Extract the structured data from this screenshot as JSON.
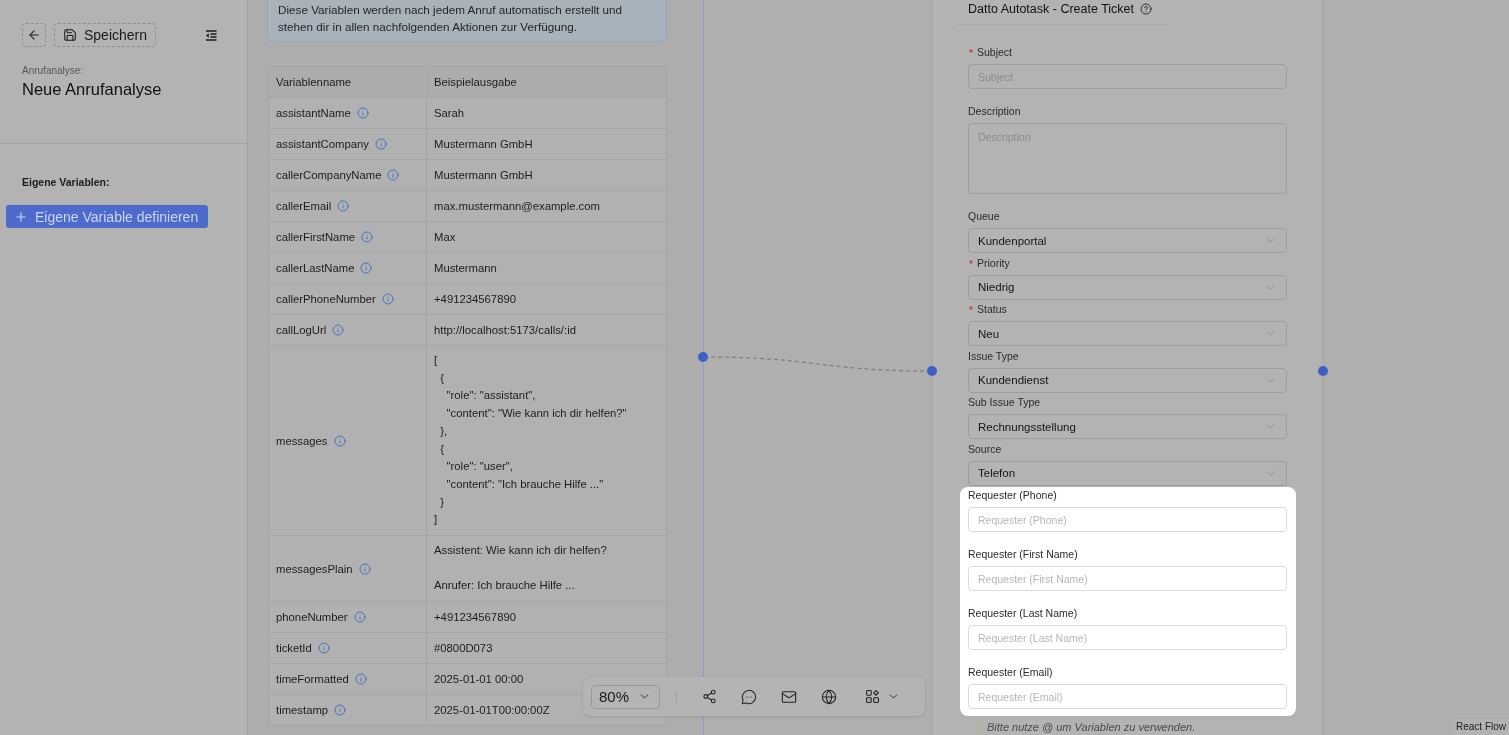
{
  "header": {
    "save_label": "Speichern",
    "caption": "Anrufanalyse:",
    "title": "Neue Anrufanalyse"
  },
  "custom_variables": {
    "heading": "Eigene Variablen:",
    "add_label": "Eigene Variable definieren"
  },
  "info_notice": "Diese Variablen werden nach jedem Anruf automatisch erstellt und stehen dir in allen nachfolgenden Aktionen zur Verfügung.",
  "variables_table": {
    "columns": [
      "Variablenname",
      "Beispielausgabe"
    ],
    "rows": [
      {
        "name": "assistantName",
        "example": "Sarah"
      },
      {
        "name": "assistantCompany",
        "example": "Mustermann GmbH"
      },
      {
        "name": "callerCompanyName",
        "example": "Mustermann GmbH"
      },
      {
        "name": "callerEmail",
        "example": "max.mustermann@example.com"
      },
      {
        "name": "callerFirstName",
        "example": "Max"
      },
      {
        "name": "callerLastName",
        "example": "Mustermann"
      },
      {
        "name": "callerPhoneNumber",
        "example": "+491234567890"
      },
      {
        "name": "callLogUrl",
        "example": "http://localhost:5173/calls/:id"
      },
      {
        "name": "messages",
        "example": "[\n  {\n    \"role\": \"assistant\",\n    \"content\": \"Wie kann ich dir helfen?\"\n  },\n  {\n    \"role\": \"user\",\n    \"content\": \"Ich brauche Hilfe ...\"\n  }\n]"
      },
      {
        "name": "messagesPlain",
        "example": "Assistent: Wie kann ich dir helfen?\n\nAnrufer: Ich brauche Hilfe ..."
      },
      {
        "name": "phoneNumber",
        "example": "+491234567890"
      },
      {
        "name": "ticketId",
        "example": "#0800D073"
      },
      {
        "name": "timeFormatted",
        "example": "2025-01-01 00:00"
      },
      {
        "name": "timestamp",
        "example": "2025-01-01T00:00:00Z"
      }
    ]
  },
  "node": {
    "title": "Datto Autotask - Create Ticket",
    "fields": [
      {
        "kind": "text",
        "label": "Subject",
        "required": true,
        "placeholder": "Subject"
      },
      {
        "kind": "textarea",
        "label": "Description",
        "required": false,
        "placeholder": "Description"
      },
      {
        "kind": "select",
        "label": "Queue",
        "required": false,
        "value": "Kundenportal"
      },
      {
        "kind": "select",
        "label": "Priority",
        "required": true,
        "value": "Niedrig"
      },
      {
        "kind": "select",
        "label": "Status",
        "required": true,
        "value": "Neu"
      },
      {
        "kind": "select",
        "label": "Issue Type",
        "required": false,
        "value": "Kundendienst"
      },
      {
        "kind": "select",
        "label": "Sub Issue Type",
        "required": false,
        "value": "Rechnungsstellung"
      },
      {
        "kind": "select",
        "label": "Source",
        "required": false,
        "value": "Telefon"
      }
    ],
    "spotlight_fields": [
      {
        "kind": "text",
        "label": "Requester (Phone)",
        "required": false,
        "placeholder": "Requester (Phone)"
      },
      {
        "kind": "text",
        "label": "Requester (First Name)",
        "required": false,
        "placeholder": "Requester (First Name)"
      },
      {
        "kind": "text",
        "label": "Requester (Last Name)",
        "required": false,
        "placeholder": "Requester (Last Name)"
      },
      {
        "kind": "text",
        "label": "Requester (Email)",
        "required": false,
        "placeholder": "Requester (Email)"
      }
    ],
    "hint": "Bitte nutze @ um Variablen zu verwenden."
  },
  "zoom_control": {
    "value": "80%"
  },
  "attribution": "React Flow"
}
